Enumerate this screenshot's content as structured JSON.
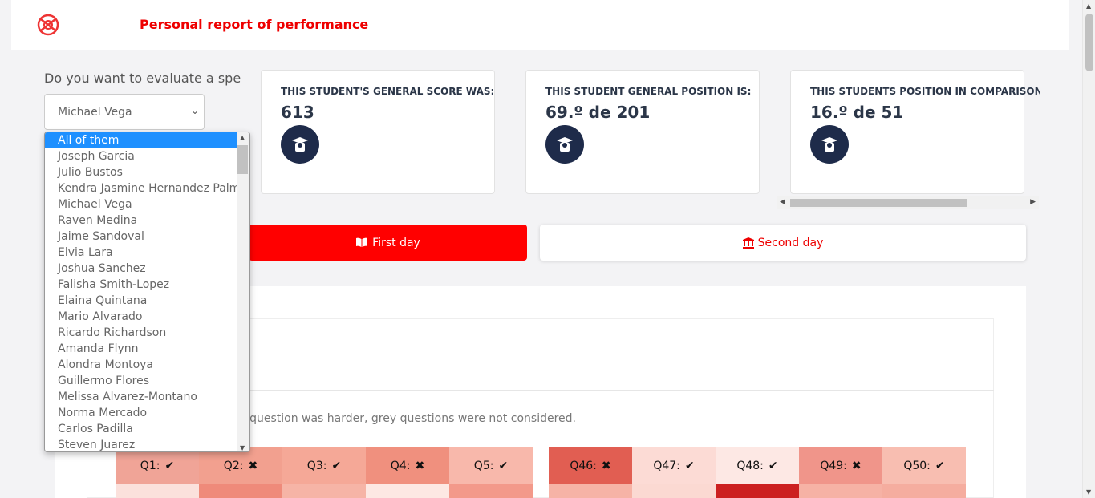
{
  "header": {
    "title": "Personal report of performance",
    "logo_icon": "broken-target-logo"
  },
  "filter": {
    "question": "Do you want to evaluate a specifi",
    "selected": "Michael Vega",
    "options": [
      "All of them",
      "Joseph Garcia",
      "Julio Bustos",
      "Kendra Jasmine Hernandez Palma",
      "Michael Vega",
      "Raven Medina",
      "Jaime Sandoval",
      "Elvia Lara",
      "Joshua Sanchez",
      "Falisha Smith-Lopez",
      "Elaina Quintana",
      "Mario Alvarado",
      "Ricardo Richardson",
      "Amanda Flynn",
      "Alondra Montoya",
      "Guillermo Flores",
      "Melissa Alvarez-Montano",
      "Norma Mercado",
      "Carlos Padilla",
      "Steven Juarez"
    ],
    "highlighted_index": 0
  },
  "cards": [
    {
      "label": "THIS STUDENT'S GENERAL SCORE WAS:",
      "value": "613",
      "icon": "graduate-icon"
    },
    {
      "label": "THIS STUDENT GENERAL POSITION IS:",
      "value": "69.º de 201",
      "icon": "graduate-icon"
    },
    {
      "label": "THIS STUDENTS POSITION IN COMPARISON W",
      "value": "16.º de 51",
      "icon": "graduate-icon"
    }
  ],
  "days": {
    "first": "First day",
    "second": "Second day"
  },
  "note": "ns the question was harder, grey questions were not considered.",
  "questions_left": [
    {
      "label": "Q1:",
      "correct": true,
      "color": "#f0a497",
      "below": "#fbe1dc"
    },
    {
      "label": "Q2:",
      "correct": false,
      "color": "#f2a08f",
      "below": "#ef8a7a"
    },
    {
      "label": "Q3:",
      "correct": true,
      "color": "#f5a897",
      "below": "#f6b4a6"
    },
    {
      "label": "Q4:",
      "correct": false,
      "color": "#f0907e",
      "below": "#fde8e3"
    },
    {
      "label": "Q5:",
      "correct": true,
      "color": "#f8b8ab",
      "below": "#f3998a"
    }
  ],
  "questions_right": [
    {
      "label": "Q46:",
      "correct": false,
      "color": "#e15e52",
      "below": "#f6b3a6"
    },
    {
      "label": "Q47:",
      "correct": true,
      "color": "#fcdbd5",
      "below": "#fbd9d2"
    },
    {
      "label": "Q48:",
      "correct": true,
      "color": "#fde8e4",
      "below": "#cc2020"
    },
    {
      "label": "Q49:",
      "correct": false,
      "color": "#f0958a",
      "below": "#f6b2a5"
    },
    {
      "label": "Q50:",
      "correct": true,
      "color": "#f8beb1",
      "below": "#f5ad9f"
    }
  ],
  "marks": {
    "correct": "✔",
    "wrong": "✖"
  }
}
